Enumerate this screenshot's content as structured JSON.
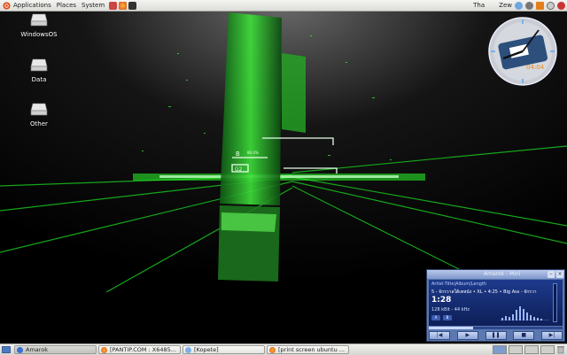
{
  "top_panel": {
    "menus": [
      "Applications",
      "Places",
      "System"
    ],
    "user_label": "Tha",
    "keyboard_label": "Zew"
  },
  "desktop": {
    "icons": [
      {
        "label": "WindowsOS",
        "icon": "drive-icon"
      },
      {
        "label": "Data",
        "icon": "drive-icon"
      },
      {
        "label": "Other",
        "icon": "drive-icon"
      }
    ]
  },
  "wallpaper": {
    "visible_text": {
      "b": "B",
      "percent": "80.0%",
      "g2": "G2"
    },
    "accent": "#2cff3a"
  },
  "clock_widget": {
    "display": "04:04"
  },
  "amarok_player": {
    "window_title": "Amarok - Mini",
    "column_header": "Artist-Title|Album|Length",
    "track_line": "5 - จักรวาลใต้เตหนัง • XL • 4:25 • Big Ass - จักรวา",
    "elapsed": "1:28",
    "bitrate": "128 kBit - 44 kHz",
    "btn_a": "A",
    "btn_b": "B",
    "progress": 0.33,
    "controls": [
      "prev",
      "play",
      "pause",
      "stop",
      "next"
    ],
    "colors": {
      "body": "#5b78b0",
      "screen": "#1d3a8c"
    }
  },
  "bottom_panel": {
    "tasks": [
      {
        "label": "Amarok",
        "icon": "amarok-icon"
      },
      {
        "label": "[PANTIP.COM : X6485...",
        "icon": "firefox-icon"
      },
      {
        "label": "[Kopete]",
        "icon": "kopete-icon"
      },
      {
        "label": "[print screen ubuntu ...",
        "icon": "firefox-icon"
      }
    ]
  }
}
